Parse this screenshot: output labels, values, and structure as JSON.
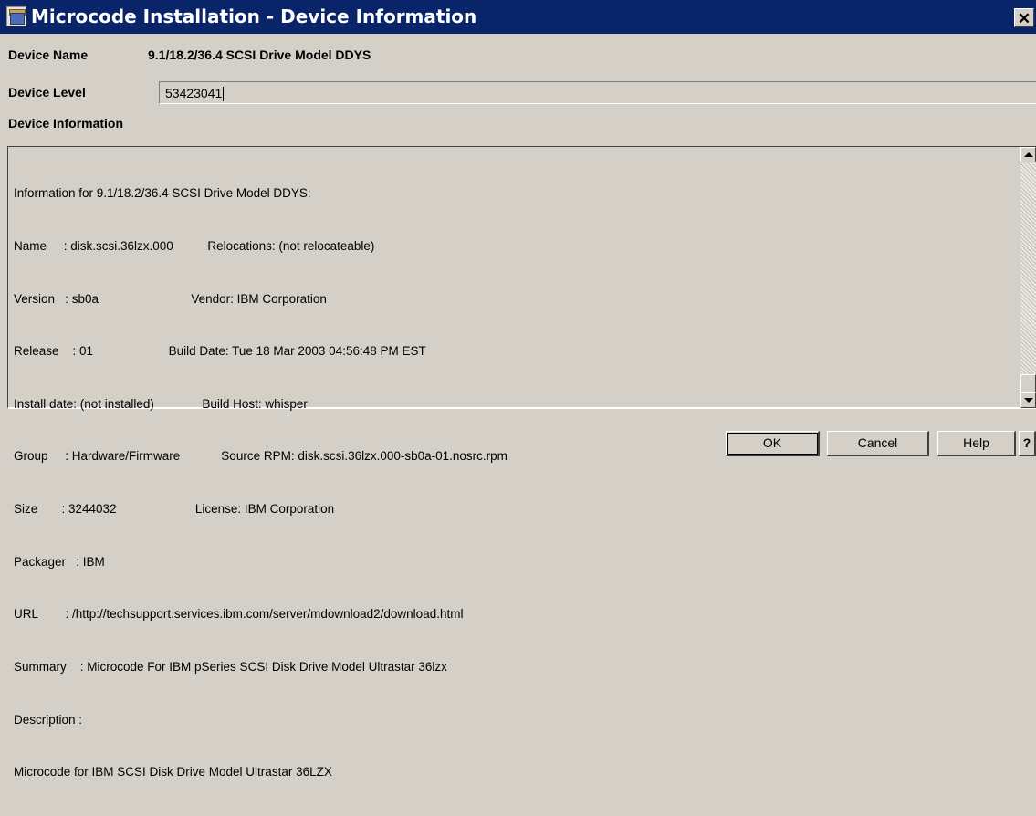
{
  "window": {
    "title": "Microcode Installation - Device Information",
    "close_glyph": "✕"
  },
  "device": {
    "name_label": "Device Name",
    "name_value": "9.1/18.2/36.4 SCSI Drive Model DDYS",
    "level_label": "Device Level",
    "level_value": "53423041",
    "info_label": "Device Information"
  },
  "info_lines": [
    "Information for 9.1/18.2/36.4 SCSI Drive Model DDYS:",
    "Name     : disk.scsi.36lzx.000          Relocations: (not relocateable)",
    "Version   : sb0a                           Vendor: IBM Corporation",
    "Release    : 01                      Build Date: Tue 18 Mar 2003 04:56:48 PM EST",
    "Install date: (not installed)              Build Host: whisper",
    "Group     : Hardware/Firmware            Source RPM: disk.scsi.36lzx.000-sb0a-01.nosrc.rpm",
    "Size       : 3244032                       License: IBM Corporation",
    "Packager   : IBM",
    "URL        : /http://techsupport.services.ibm.com/server/mdownload2/download.html",
    "Summary    : Microcode For IBM pSeries SCSI Disk Drive Model Ultrastar 36lzx",
    "Description :",
    "Microcode for IBM SCSI Disk Drive Model Ultrastar 36LZX"
  ],
  "buttons": {
    "ok": "OK",
    "cancel": "Cancel",
    "help": "Help",
    "context_help": "?"
  },
  "icons": {
    "app": "package-icon",
    "close": "close-icon",
    "scroll_up": "arrow-up-icon",
    "scroll_down": "arrow-down-icon"
  },
  "colors": {
    "titlebar": "#0a246a",
    "background": "#d4d0c8"
  }
}
